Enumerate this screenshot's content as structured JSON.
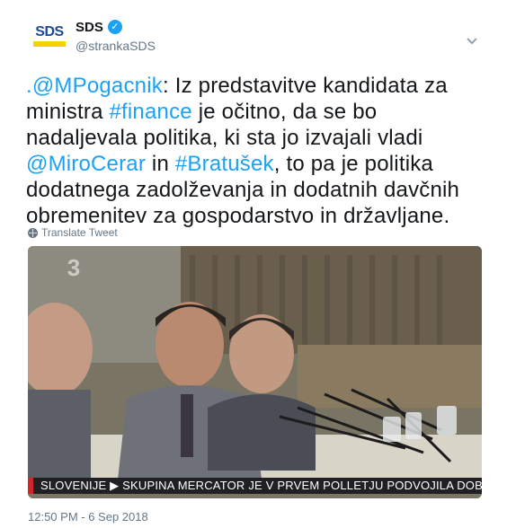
{
  "author": {
    "avatar_text": "SDS",
    "display_name": "SDS",
    "handle": "@strankaSDS",
    "verified_mark": "✓"
  },
  "tweet": {
    "mention_1": ".@MPogacnik",
    "text_1": ": Iz predstavitve kandidata za ministra ",
    "hashtag_1": "#finance",
    "text_2": " je očitno, da se bo nadaljevala politika, ki sta jo izvajali vladi ",
    "mention_2": "@MiroCerar",
    "text_3": " in ",
    "hashtag_2": "#Bratušek",
    "text_4": ", to pa je politika dodatnega zadolževanja in dodatnih davčnih obremenitev za gospodarstvo in državljane."
  },
  "translate_label": "Translate Tweet",
  "media": {
    "channel_logo": "3",
    "ticker_text": "SLOVENIJE  ▶ SKUPINA MERCATOR JE V PRVEM POLLETJU PODVOJILA DOBIČEK IZ"
  },
  "timestamp": "12:50 PM - 6 Sep 2018",
  "icons": {
    "verified": "verified-badge-icon",
    "menu": "chevron-down-icon",
    "translate": "globe-icon"
  },
  "colors": {
    "link": "#1da1f2",
    "text": "#14171a",
    "muted": "#657786",
    "brand_blue": "#1a4a9c",
    "brand_yellow": "#f5d100"
  }
}
